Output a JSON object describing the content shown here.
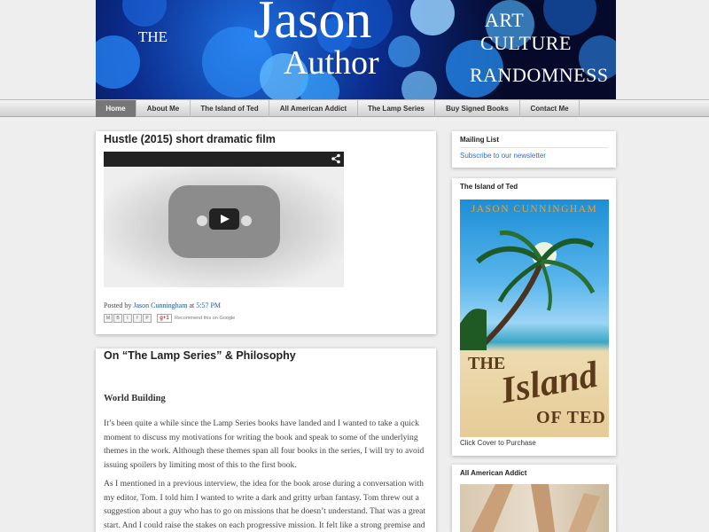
{
  "header": {
    "the": "THE",
    "name": "Jason",
    "role": "Author",
    "taglines": [
      "ART",
      "CULTURE",
      "RANDOMNESS"
    ]
  },
  "nav": {
    "items": [
      "Home",
      "About Me",
      "The Island of Ted",
      "All American Addict",
      "The Lamp Series",
      "Buy Signed Books",
      "Contact Me"
    ],
    "active": "Home"
  },
  "posts": [
    {
      "title": "Hustle (2015) short dramatic film",
      "posted_by_label": "Posted by",
      "author": "Jason Cunningham",
      "at_label": "at",
      "time": "5:57 PM",
      "share_buttons": [
        "M",
        "B",
        "t",
        "f",
        "P"
      ],
      "gplus_label": "g+1",
      "recommend_label": "Recommend this on Google"
    },
    {
      "title": "On “The Lamp Series” & Philosophy",
      "section_heading": "World Building",
      "paragraphs": [
        "It’s been quite a while since the Lamp Series books have landed and I wanted to take a quick moment to discuss my motivations for writing the book and speak to some of the underlying themes in the work. Although these themes span all four books in the series, I will try to avoid issuing spoilers by limiting most of this to the first book.",
        "As I mentioned in a previous interview, the idea for the book arose during a conversation with my editor, Tom. I told him I wanted to write a dark and gritty urban fantasy. Tom threw out a suggestion about a guy who has to go on missions that he doesn’t understand. That was a great start. And I could raise the stakes on each progressive mission. It felt like a strong premise and the mystery element intrigued me. Our hero would carry a lamp and"
      ]
    }
  ],
  "sidebar": {
    "mailing_list": {
      "title": "Mailing List",
      "link": "Subscribe to our newsletter"
    },
    "island_of_ted": {
      "title": "The Island of Ted",
      "cover_author": "JASON CUNNINGHAM",
      "cover_the": "THE",
      "cover_island": "Island",
      "cover_of_ted": "OF TED",
      "caption": "Click Cover to Purchase"
    },
    "all_american_addict": {
      "title": "All American Addict"
    }
  }
}
